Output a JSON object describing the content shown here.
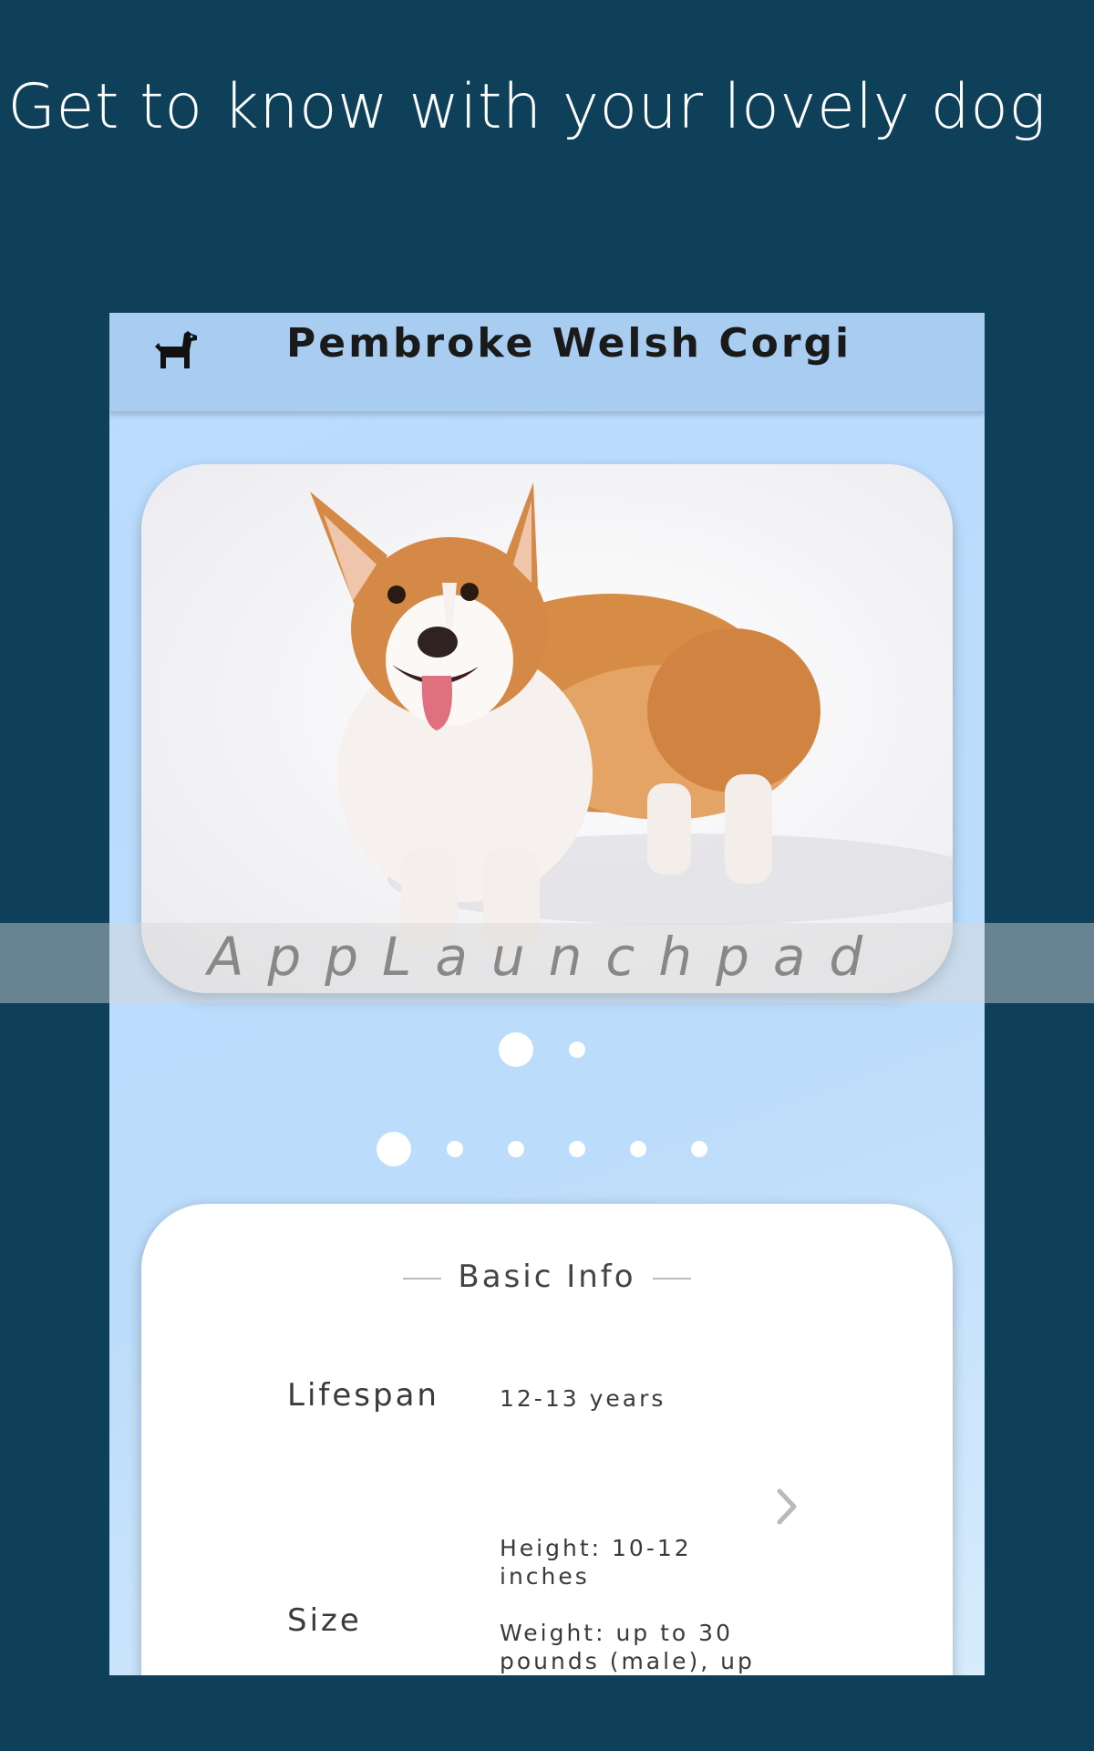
{
  "promo": {
    "headline": "Get to know with your lovely dog"
  },
  "app_bar": {
    "icon": "dog-icon",
    "title": "Pembroke Welsh Corgi"
  },
  "photo_carousel": {
    "image": "corgi-photo",
    "page_count": 2,
    "active_page": 1
  },
  "section_pager": {
    "page_count": 6,
    "active_page": 1
  },
  "basic_info": {
    "title": "Basic Info",
    "rows": [
      {
        "label": "Lifespan",
        "value": "12-13 years"
      },
      {
        "label": "Size",
        "value_lines": [
          "Height: 10-12",
          "inches",
          "Weight: up to 30",
          "pounds (male), up"
        ]
      }
    ],
    "next_icon": "chevron-right-icon"
  },
  "watermark": {
    "text": "AppLaunchpad"
  },
  "colors": {
    "background": "#0e4059",
    "app_bar": "#a9cdf1",
    "screen": "#bcdcfb"
  }
}
